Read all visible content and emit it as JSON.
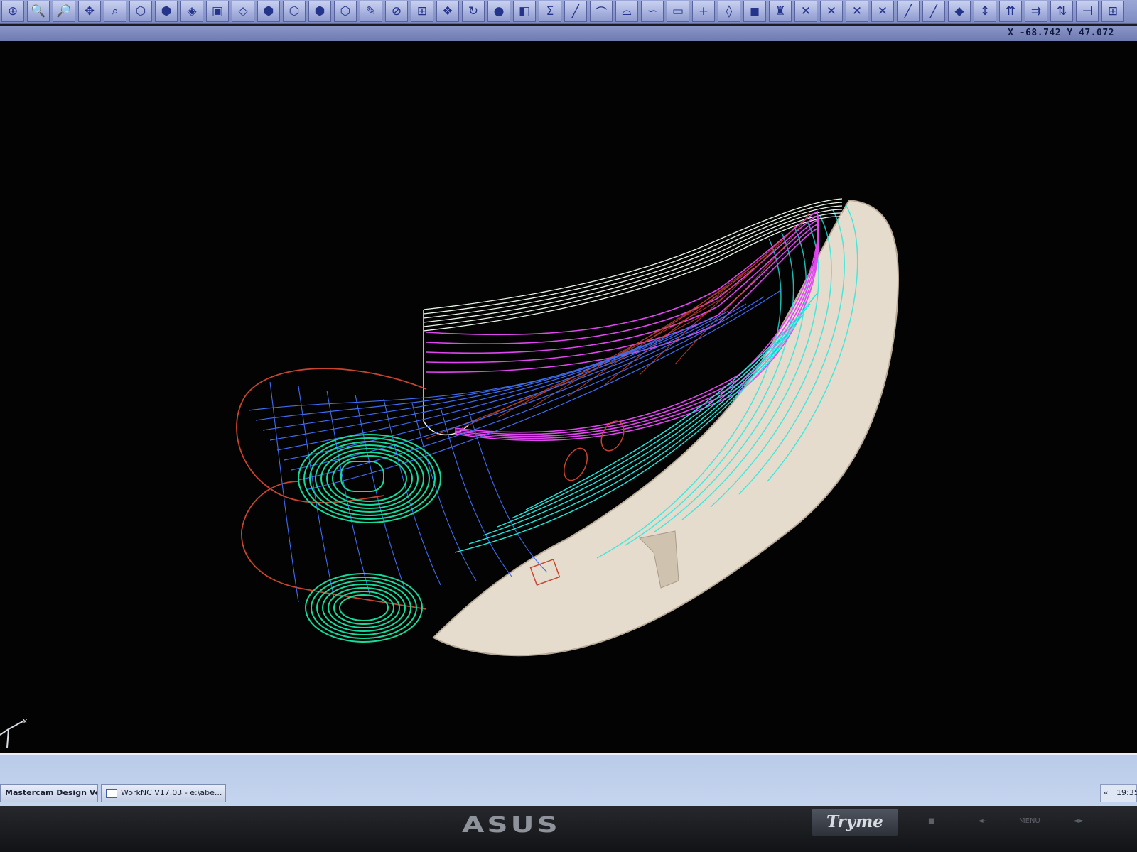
{
  "toolbar": {
    "tools": [
      {
        "name": "zoom-window-icon",
        "glyph": "⊕"
      },
      {
        "name": "zoom-in-icon",
        "glyph": "🔍"
      },
      {
        "name": "zoom-out-icon",
        "glyph": "🔎"
      },
      {
        "name": "pan-icon",
        "glyph": "✥"
      },
      {
        "name": "zoom-select-icon",
        "glyph": "⌕"
      },
      {
        "name": "view-iso-icon",
        "glyph": "⬡"
      },
      {
        "name": "view-top-icon",
        "glyph": "⬢"
      },
      {
        "name": "view-front-icon",
        "glyph": "◈"
      },
      {
        "name": "view-side-icon",
        "glyph": "▣"
      },
      {
        "name": "view-right-icon",
        "glyph": "◇"
      },
      {
        "name": "cube-solid-icon",
        "glyph": "⬢"
      },
      {
        "name": "cube-wire-icon",
        "glyph": "⬡"
      },
      {
        "name": "cube-shaded-icon",
        "glyph": "⬢"
      },
      {
        "name": "cube-hidden-icon",
        "glyph": "⬡"
      },
      {
        "name": "pencil-icon",
        "glyph": "✎"
      },
      {
        "name": "no-entry-icon",
        "glyph": "⊘"
      },
      {
        "name": "snap-icon",
        "glyph": "⊞"
      },
      {
        "name": "layers-icon",
        "glyph": "❖"
      },
      {
        "name": "rotate-icon",
        "glyph": "↻"
      },
      {
        "name": "sphere-icon",
        "glyph": "●"
      },
      {
        "name": "solids-icon",
        "glyph": "◧"
      },
      {
        "name": "sigma-icon",
        "glyph": "Σ"
      },
      {
        "name": "line-icon",
        "glyph": "╱"
      },
      {
        "name": "arc-icon",
        "glyph": "⌒"
      },
      {
        "name": "fillet-icon",
        "glyph": "⌓"
      },
      {
        "name": "curve-icon",
        "glyph": "∽"
      },
      {
        "name": "rectangle-icon",
        "glyph": "▭"
      },
      {
        "name": "point-icon",
        "glyph": "+"
      },
      {
        "name": "plane-icon",
        "glyph": "◊"
      },
      {
        "name": "box-icon",
        "glyph": "◼"
      },
      {
        "name": "tower-icon",
        "glyph": "♜"
      },
      {
        "name": "trim-icon",
        "glyph": "✕"
      },
      {
        "name": "break-icon",
        "glyph": "✕"
      },
      {
        "name": "extend-icon",
        "glyph": "✕"
      },
      {
        "name": "join-icon",
        "glyph": "✕"
      },
      {
        "name": "offset-icon",
        "glyph": "╱"
      },
      {
        "name": "project-icon",
        "glyph": "╱"
      },
      {
        "name": "surface-icon",
        "glyph": "◆"
      },
      {
        "name": "xform-icon",
        "glyph": "↕"
      },
      {
        "name": "toolpath-icon",
        "glyph": "⇈"
      },
      {
        "name": "backplot-icon",
        "glyph": "⇉"
      },
      {
        "name": "verify-icon",
        "glyph": "⇅"
      },
      {
        "name": "post-icon",
        "glyph": "⊣"
      },
      {
        "name": "grid-icon",
        "glyph": "⊞"
      }
    ]
  },
  "status": {
    "coordinates": "X -68.742  Y 47.072"
  },
  "viewport": {
    "background_color": "#030303",
    "axis_labels": {
      "x": "x",
      "z": "z"
    },
    "wire_colors": {
      "red": "#c8442e",
      "blue": "#3f6cf0",
      "magenta": "#e047f0",
      "green": "#17d99a",
      "cyan": "#20e8dc",
      "white": "#e8f5e8",
      "shell": "#e6dccd"
    }
  },
  "taskbar": {
    "items": [
      {
        "label": "Mastercam Design Ve..."
      },
      {
        "label": "WorkNC V17.03 - e:\\abe..."
      }
    ],
    "tray_arrow": "«",
    "clock": "19:35"
  },
  "monitor": {
    "brand": "ASUS",
    "badge": "Tryme",
    "buttons": [
      "■",
      "◄-",
      "MENU",
      "◄►"
    ]
  }
}
